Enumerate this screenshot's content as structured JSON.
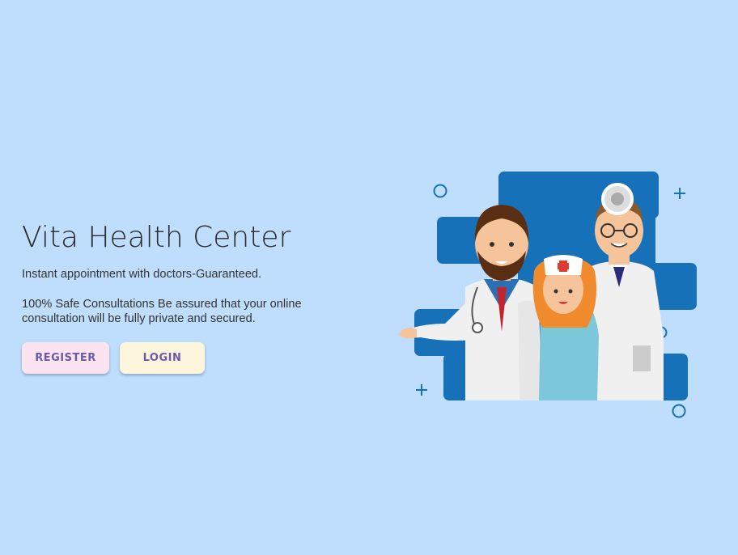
{
  "hero": {
    "title": "Vita Health Center",
    "tagline": "Instant appointment with doctors-Guaranteed.",
    "description": "100% Safe Consultations Be assured that your online consultation will be fully private and secured."
  },
  "actions": {
    "register_label": "REGISTER",
    "login_label": "LOGIN"
  },
  "colors": {
    "background": "#bfdefd",
    "illustration_blue": "#1771b8",
    "button_text": "#6a5aa8",
    "register_bg": "#fbe4f0",
    "login_bg": "#fdf5dc"
  },
  "illustration": {
    "subject": "doctors-and-nurse-illustration"
  }
}
